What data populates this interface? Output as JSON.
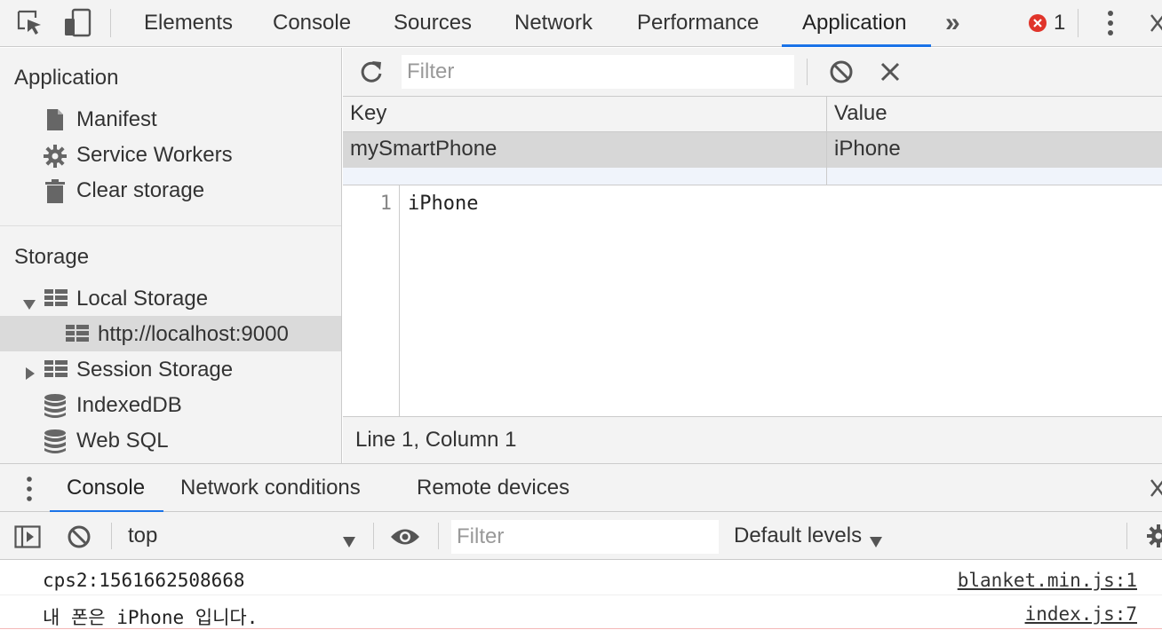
{
  "toolbar": {
    "tabs": [
      {
        "label": "Elements"
      },
      {
        "label": "Console"
      },
      {
        "label": "Sources"
      },
      {
        "label": "Network"
      },
      {
        "label": "Performance"
      },
      {
        "label": "Application"
      }
    ],
    "active_tab": "Application",
    "more_tabs_label": "»",
    "error_count": "1"
  },
  "sidebar": {
    "application_header": "Application",
    "application_items": [
      {
        "label": "Manifest",
        "icon": "file-icon"
      },
      {
        "label": "Service Workers",
        "icon": "gear-icon"
      },
      {
        "label": "Clear storage",
        "icon": "trash-icon"
      }
    ],
    "storage_header": "Storage",
    "storage_items": [
      {
        "label": "Local Storage",
        "icon": "grid-icon",
        "expanded": true
      },
      {
        "label": "http://localhost:9000",
        "icon": "grid-icon",
        "selected": true
      },
      {
        "label": "Session Storage",
        "icon": "grid-icon",
        "expanded": false
      },
      {
        "label": "IndexedDB",
        "icon": "database-icon"
      },
      {
        "label": "Web SQL",
        "icon": "database-icon"
      }
    ]
  },
  "storage_view": {
    "filter_placeholder": "Filter",
    "columns": {
      "key": "Key",
      "value": "Value"
    },
    "rows": [
      {
        "key": "mySmartPhone",
        "value": "iPhone"
      }
    ],
    "editor_line_number": "1",
    "editor_content": "iPhone",
    "status": "Line 1, Column 1"
  },
  "drawer": {
    "tabs": [
      {
        "label": "Console"
      },
      {
        "label": "Network conditions"
      },
      {
        "label": "Remote devices"
      }
    ],
    "active_tab": "Console"
  },
  "console": {
    "context": "top",
    "filter_placeholder": "Filter",
    "levels_label": "Default levels",
    "messages": [
      {
        "text": "cps2:1561662508668",
        "source": "blanket.min.js:1"
      },
      {
        "text": "내 폰은 iPhone 입니다.",
        "source": "index.js:7"
      }
    ]
  },
  "colors": {
    "accent": "#1a73e8",
    "error": "#e0342a",
    "toolbar_bg": "#f3f3f3",
    "selected_bg": "#dadada"
  }
}
